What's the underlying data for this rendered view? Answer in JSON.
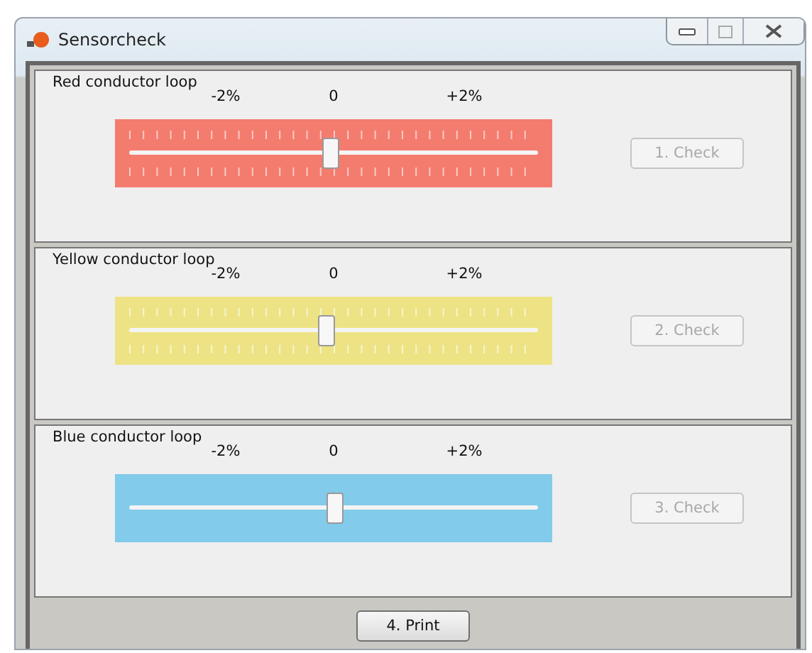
{
  "window": {
    "title": "Sensorcheck"
  },
  "loops": [
    {
      "title": "Red conductor loop",
      "color": "#f47c6e",
      "ticks": true,
      "scale": [
        "-2%",
        "0",
        "+2%"
      ],
      "level": 0.49,
      "button": {
        "label": "1. Check",
        "disabled": true
      }
    },
    {
      "title": "Yellow conductor loop",
      "color": "#ede385",
      "ticks": true,
      "scale": [
        "-2%",
        "0",
        "+2%"
      ],
      "level": 0.48,
      "button": {
        "label": "2. Check",
        "disabled": true
      }
    },
    {
      "title": "Blue conductor loop",
      "color": "#82cbea",
      "ticks": false,
      "scale": [
        "-2%",
        "0",
        "+2%"
      ],
      "level": 0.5,
      "button": {
        "label": "3. Check",
        "disabled": true
      }
    }
  ],
  "print_button": {
    "label": "4. Print",
    "disabled": false
  }
}
